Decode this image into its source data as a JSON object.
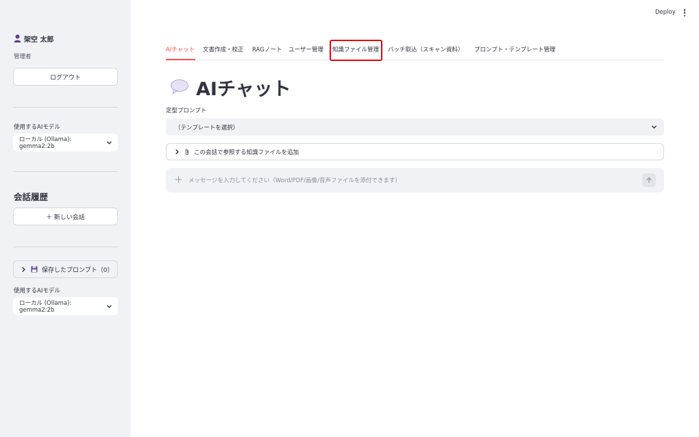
{
  "sidebar": {
    "user_name": "架空 太郎",
    "role": "管理者",
    "logout_label": "ログアウト",
    "model_label_1": "使用するAIモデル",
    "model_value_1": "ローカル (Ollama): gemma2:2b",
    "history_heading": "会話履歴",
    "new_chat_label": "＋ 新しい会話",
    "saved_prompts_label": "保存したプロンプト（0）",
    "model_label_2": "使用するAIモデル",
    "model_value_2": "ローカル (Ollama): gemma2:2b"
  },
  "topbar": {
    "deploy_label": "Deploy"
  },
  "tabs": [
    {
      "label": "AIチャット",
      "active": true
    },
    {
      "label": "文書作成・校正",
      "active": false
    },
    {
      "label": "RAGノート",
      "active": false
    },
    {
      "label": "ユーザー管理",
      "active": false
    },
    {
      "label": "知識ファイル管理",
      "active": false,
      "highlighted": true
    },
    {
      "label": "バッチ取込（スキャン資料）",
      "active": false
    },
    {
      "label": "プロンプト・テンプレート管理",
      "active": false
    }
  ],
  "main": {
    "title": "AIチャット",
    "template_label": "定型プロンプト",
    "template_value": "（テンプレートを選択）",
    "knowledge_expander": "この会話で参照する知識ファイルを追加",
    "chat_placeholder": "メッセージを入力してください（Word/PDF/画像/音声ファイルを添付できます）"
  },
  "colors": {
    "accent": "#ff4b4b",
    "highlight_border": "#e8000b",
    "sidebar_bg": "#f0f2f6",
    "text": "#31333f"
  }
}
